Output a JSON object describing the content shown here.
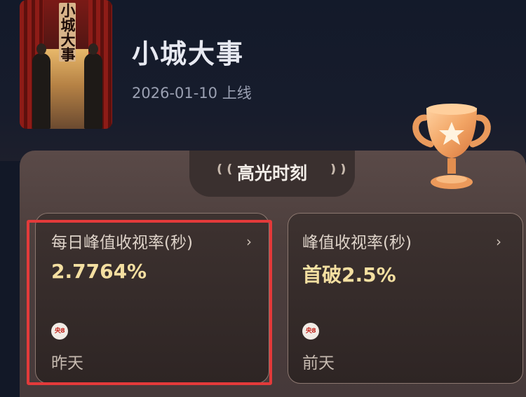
{
  "show": {
    "poster_title": "小城大事",
    "title": "小城大事",
    "release": "2026-01-10 上线"
  },
  "highlights": {
    "heading": "高光时刻",
    "cards": [
      {
        "label": "每日峰值收视率(秒)",
        "value": "2.7764%",
        "channel_badge": "央8",
        "when": "昨天",
        "highlighted": true
      },
      {
        "label": "峰值收视率(秒)",
        "value": "首破2.5%",
        "channel_badge": "央8",
        "when": "前天",
        "highlighted": false
      }
    ]
  },
  "icons": {
    "trophy": "trophy-star-icon",
    "chevron": "chevron-right-icon",
    "decor": "wheat-laurel-icon"
  },
  "colors": {
    "background": "#121827",
    "panel": "#4d3f3d",
    "value_gold": "#f4dfa1",
    "highlight_outline": "#e33a3a",
    "trophy": "#f0a25e"
  }
}
